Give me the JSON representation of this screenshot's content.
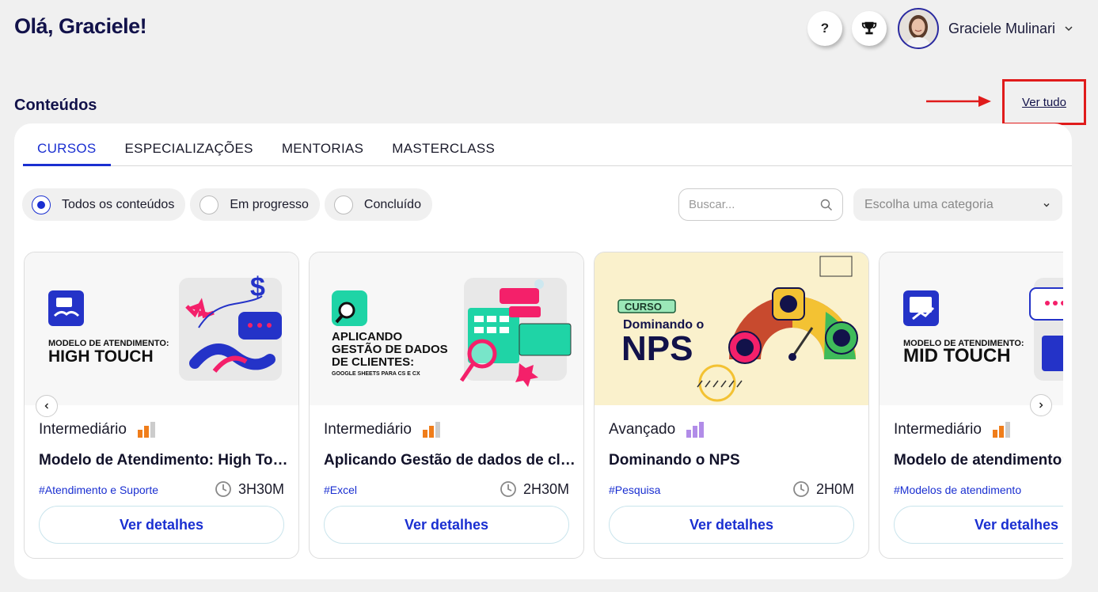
{
  "header": {
    "greeting": "Olá, Graciele!",
    "help_label": "?",
    "user_name": "Graciele Mulinari"
  },
  "section": {
    "title": "Conteúdos",
    "see_all": "Ver tudo"
  },
  "tabs": [
    {
      "label": "CURSOS",
      "active": true
    },
    {
      "label": "ESPECIALIZAÇÕES",
      "active": false
    },
    {
      "label": "MENTORIAS",
      "active": false
    },
    {
      "label": "MASTERCLASS",
      "active": false
    }
  ],
  "filters": [
    {
      "label": "Todos os conteúdos",
      "selected": true
    },
    {
      "label": "Em progresso",
      "selected": false
    },
    {
      "label": "Concluído",
      "selected": false
    }
  ],
  "search": {
    "placeholder": "Buscar..."
  },
  "category_select": {
    "value": "Escolha uma categoria"
  },
  "cards": [
    {
      "image_kicker": "MODELO DE ATENDIMENTO:",
      "image_title": "HIGH TOUCH",
      "level": "Intermediário",
      "level_value": 2,
      "title": "Modelo de Atendimento: High Touch",
      "tag": "#Atendimento e Suporte",
      "duration": "3H30M",
      "button": "Ver detalhes"
    },
    {
      "image_title_lines": [
        "APLICANDO",
        "GESTÃO DE DADOS",
        "DE CLIENTES:"
      ],
      "image_sub": "GOOGLE SHEETS PARA CS E CX",
      "level": "Intermediário",
      "level_value": 2,
      "title": "Aplicando Gestão de dados de clientes",
      "tag": "#Excel",
      "duration": "2H30M",
      "button": "Ver detalhes"
    },
    {
      "image_badge": "CURSO",
      "image_kicker": "Dominando o",
      "image_title": "NPS",
      "level": "Avançado",
      "level_value": 3,
      "title": "Dominando o NPS",
      "tag": "#Pesquisa",
      "duration": "2H0M",
      "button": "Ver detalhes"
    },
    {
      "image_kicker": "MODELO DE ATENDIMENTO:",
      "image_title": "MID TOUCH",
      "level": "Intermediário",
      "level_value": 2,
      "title": "Modelo de atendimento: Mid Touch",
      "tag": "#Modelos de atendimento",
      "duration": "",
      "button": "Ver detalhes"
    }
  ],
  "colors": {
    "accent": "#1a2fd1",
    "navy": "#12124a",
    "orange": "#f07d1a",
    "purple": "#b18ce8",
    "highlight_box": "#e01b1b"
  }
}
